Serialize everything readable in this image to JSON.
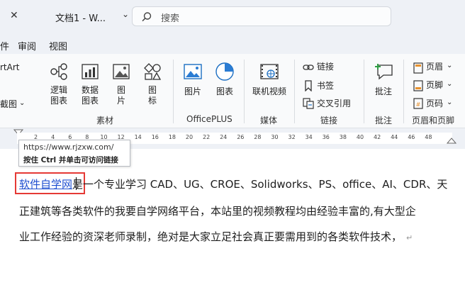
{
  "titlebar": {
    "close_glyph": "✕",
    "doc_title": "文档1 - W...",
    "chevron_glyph": "⌄",
    "search_placeholder": "搜索"
  },
  "menubar": {
    "items": [
      "件",
      "审阅",
      "视图"
    ]
  },
  "ribbon": {
    "left_partial": {
      "smartart": "rtArt",
      "screenshot": "截图"
    },
    "sucai": {
      "items": [
        {
          "line1": "逻辑",
          "line2": "图表"
        },
        {
          "line1": "数据",
          "line2": "图表"
        },
        {
          "line1": "图",
          "line2": "片"
        },
        {
          "line1": "图",
          "line2": "标"
        }
      ],
      "group": "素材"
    },
    "officeplus": {
      "items": [
        "图片",
        "图表"
      ],
      "group": "OfficePLUS"
    },
    "media": {
      "item": "联机视频",
      "group": "媒体"
    },
    "links": {
      "items": [
        "链接",
        "书签",
        "交叉引用"
      ],
      "group": "链接"
    },
    "comment": {
      "item": "批注",
      "group": "批注"
    },
    "headerfooter": {
      "items": [
        "页眉",
        "页脚",
        "页码"
      ],
      "group": "页眉和页脚"
    }
  },
  "ruler": {
    "ticks": [
      "2",
      "4",
      "6",
      "8",
      "10",
      "12",
      "14",
      "16",
      "18",
      "20",
      "22",
      "24",
      "26",
      "28",
      "30",
      "32",
      "34",
      "36",
      "38",
      "40",
      "42",
      "44",
      "46",
      "48"
    ]
  },
  "tooltip": {
    "url": "https://www.rjzxw.com/",
    "hint": "按住 Ctrl 并单击可访问链接"
  },
  "document": {
    "link_text": "软件自学网",
    "line1_rest": "是一个专业学习 CAD、UG、CROE、Solidworks、PS、office、AI、CDR、天",
    "line2": "正建筑等各类软件的我要自学网络平台，本站里的视频教程均由经验丰富的,有大型企",
    "line3": "业工作经验的资深老师录制，绝对是大家立足社会真正要需用到的各类软件技术，",
    "para_mark": "↵"
  }
}
